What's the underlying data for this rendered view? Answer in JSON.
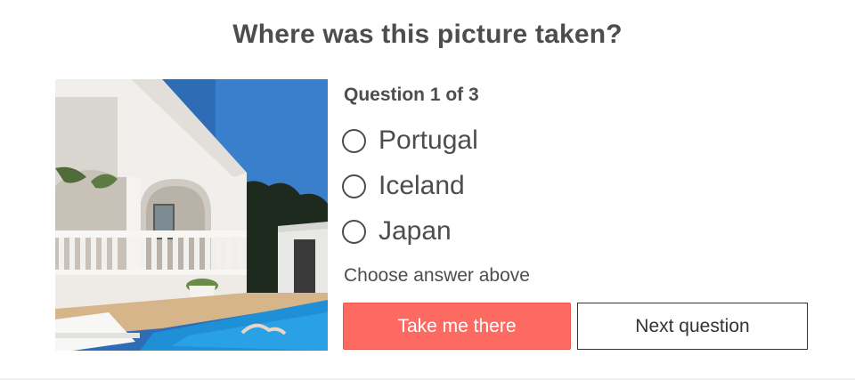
{
  "quiz": {
    "title": "Where was this picture taken?",
    "question_counter": "Question 1 of 3",
    "options": [
      {
        "label": "Portugal",
        "selected": false
      },
      {
        "label": "Iceland",
        "selected": false
      },
      {
        "label": "Japan",
        "selected": false
      }
    ],
    "hint": "Choose answer above",
    "primary_button": "Take me there",
    "secondary_button": "Next question"
  },
  "colors": {
    "primary_button_bg": "#fc6a62",
    "text": "#4d4d4f",
    "sky": "#2f6db8",
    "pool": "#1f8fd6"
  },
  "image": {
    "subject": "white villa with arched terrace and swimming pool under blue sky"
  }
}
